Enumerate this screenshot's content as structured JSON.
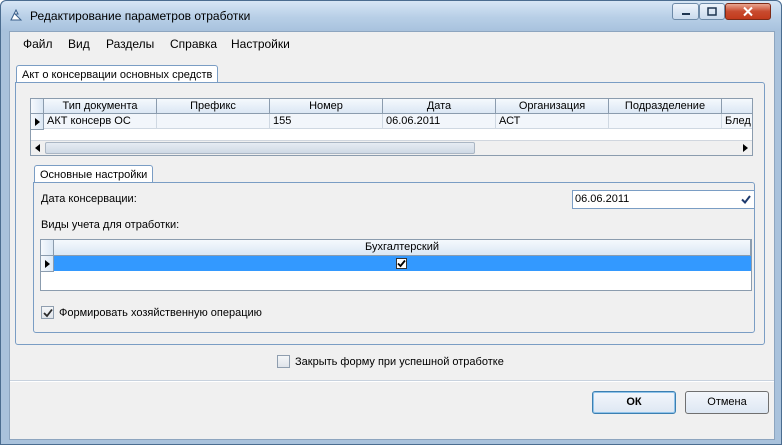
{
  "window": {
    "title": "Редактирование параметров отработки"
  },
  "menu": {
    "file": "Файл",
    "view": "Вид",
    "sections": "Разделы",
    "help": "Справка",
    "settings": "Настройки"
  },
  "doc_tab": {
    "label": "Акт о консервации основных средств"
  },
  "doc_grid": {
    "columns": [
      "Тип документа",
      "Префикс",
      "Номер",
      "Дата",
      "Организация",
      "Подразделение",
      ""
    ],
    "rows": [
      [
        "АКТ консерв ОС",
        "",
        "155",
        "06.06.2011",
        "АСТ",
        "",
        "Блед"
      ]
    ]
  },
  "settings_tab": {
    "label": "Основные настройки",
    "date_label": "Дата консервации:",
    "date_value": "06.06.2011",
    "accounting_label": "Виды учета для отработки:",
    "accounting_column": "Бухгалтерский",
    "accounting_checked": true,
    "form_operation_label": "Формировать хозяйственную операцию",
    "form_operation_checked": true
  },
  "close_on_success": {
    "label": "Закрыть форму при успешной отработке",
    "checked": false
  },
  "buttons": {
    "ok": "ОК",
    "cancel": "Отмена"
  },
  "colors": {
    "selection": "#3399ff",
    "frame": "#a9c2dc"
  }
}
